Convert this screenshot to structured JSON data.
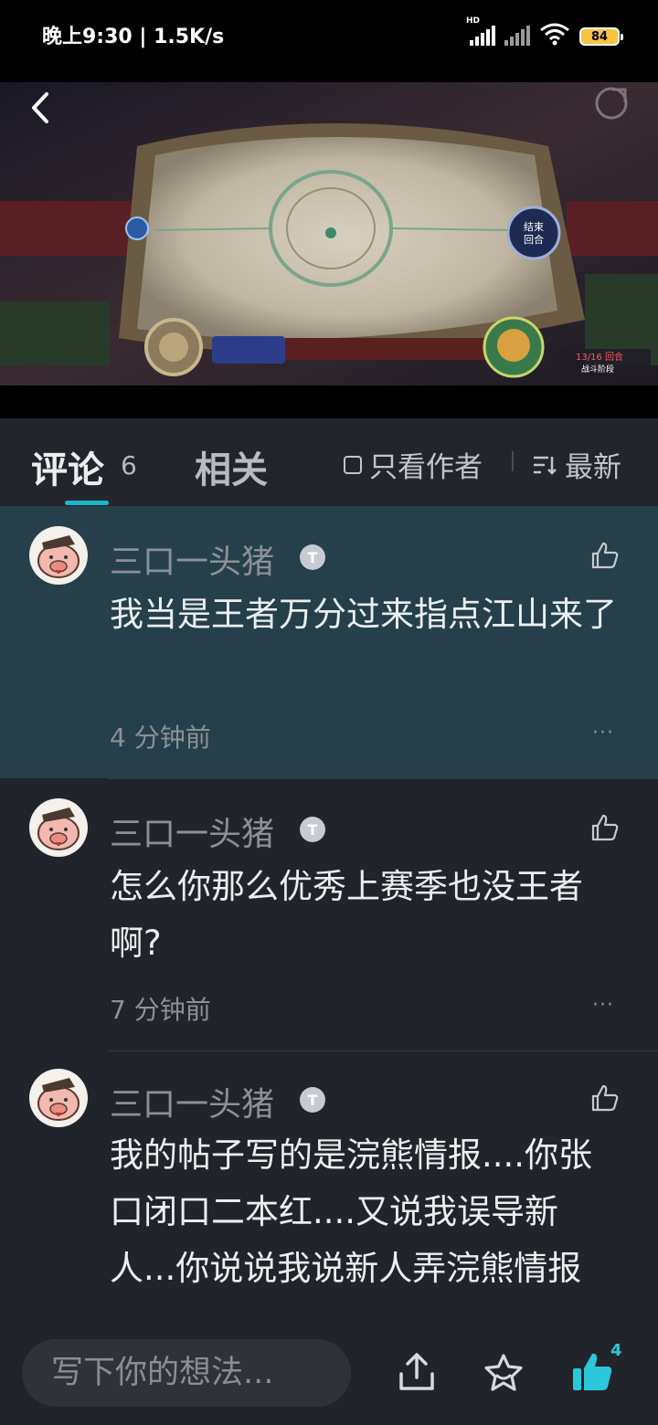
{
  "status_bar": {
    "time": "晚上9:30 | 1.5K/s",
    "battery": "84"
  },
  "video": {
    "overlay_text_1": "结束\n回合",
    "overlay_text_2": "13/16 回合",
    "overlay_text_3": "战斗阶段"
  },
  "tabs": {
    "comments_label": "评论",
    "comments_count": "6",
    "related_label": "相关",
    "author_only_label": "只看作者",
    "sort_label": "最新"
  },
  "comments": [
    {
      "user": "三口一头猪",
      "badge": "T",
      "text": "我当是王者万分过来指点江山来了",
      "time": "4 分钟前",
      "more": "···"
    },
    {
      "user": "三口一头猪",
      "badge": "T",
      "text": "怎么你那么优秀上赛季也没王者啊?",
      "time": "7 分钟前",
      "more": "···"
    },
    {
      "user": "三口一头猪",
      "badge": "T",
      "text": "我的帖子写的是浣熊情报....你张口闭口二本红....又说我误导新人...你说说我说新人弄浣熊情报",
      "time": "",
      "more": ""
    }
  ],
  "bottom_bar": {
    "input_placeholder": "写下你的想法...",
    "like_count": "4"
  },
  "colors": {
    "accent": "#1cb5c9",
    "highlight_bg": "#25404a",
    "background": "#22242b"
  },
  "icons": [
    "back-icon",
    "share-icon",
    "like-icon",
    "more-icon",
    "upload-icon",
    "favorite-icon",
    "thumbs-up-icon",
    "sort-icon",
    "checkbox-icon"
  ]
}
